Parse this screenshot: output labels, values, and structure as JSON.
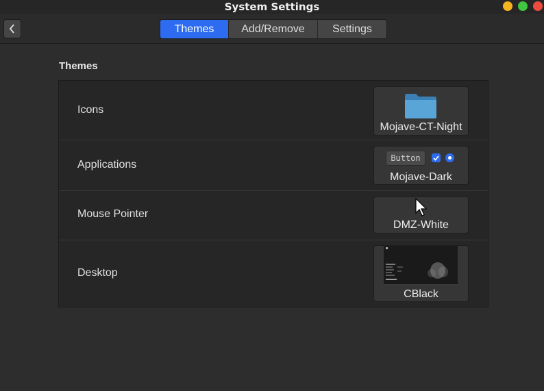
{
  "window": {
    "title": "System Settings"
  },
  "header": {
    "tabs": [
      {
        "label": "Themes",
        "active": true
      },
      {
        "label": "Add/Remove",
        "active": false
      },
      {
        "label": "Settings",
        "active": false
      }
    ]
  },
  "section": {
    "title": "Themes"
  },
  "rows": [
    {
      "label": "Icons",
      "value": "Mojave-CT-Night",
      "preview_icon": "folder-icon"
    },
    {
      "label": "Applications",
      "value": "Mojave-Dark",
      "preview_button": "Button"
    },
    {
      "label": "Mouse Pointer",
      "value": "DMZ-White",
      "preview_icon": "pointer-icon"
    },
    {
      "label": "Desktop",
      "value": "CBlack",
      "preview_icon": "desktop-thumbnail"
    }
  ],
  "colors": {
    "accent": "#2d6cf0",
    "background": "#2d2d2d",
    "panel": "#262626",
    "close": "#ec4c3f",
    "minimize": "#f5b520",
    "maximize": "#3fc53f"
  }
}
